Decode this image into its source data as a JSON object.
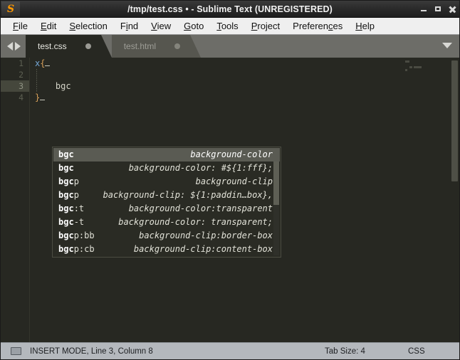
{
  "window": {
    "title": "/tmp/test.css • - Sublime Text (UNREGISTERED)",
    "logo": "sublime-s-logo",
    "controls": {
      "minimize": "minimize-icon",
      "maximize": "maximize-icon",
      "close": "close-icon"
    }
  },
  "menubar": {
    "items": [
      {
        "label": "File",
        "mnemonic_index": 0
      },
      {
        "label": "Edit",
        "mnemonic_index": 0
      },
      {
        "label": "Selection",
        "mnemonic_index": 0
      },
      {
        "label": "Find",
        "mnemonic_index": 1
      },
      {
        "label": "View",
        "mnemonic_index": 0
      },
      {
        "label": "Goto",
        "mnemonic_index": 0
      },
      {
        "label": "Tools",
        "mnemonic_index": 0
      },
      {
        "label": "Project",
        "mnemonic_index": 0
      },
      {
        "label": "Preferences",
        "mnemonic_index": 8
      },
      {
        "label": "Help",
        "mnemonic_index": 0
      }
    ]
  },
  "tabbar": {
    "prev_arrow": "arrow-left-icon",
    "next_arrow": "arrow-right-icon",
    "menu_icon": "chevron-down-icon",
    "tabs": [
      {
        "label": "test.css",
        "active": true,
        "dirty": true
      },
      {
        "label": "test.html",
        "active": false,
        "dirty": true
      }
    ]
  },
  "editor": {
    "lines": [
      {
        "number": "1",
        "active": false,
        "text": "x{"
      },
      {
        "number": "2",
        "active": false,
        "text": ""
      },
      {
        "number": "3",
        "active": true,
        "text": "    bgc"
      },
      {
        "number": "4",
        "active": false,
        "text": "}"
      }
    ]
  },
  "autocomplete": {
    "items": [
      {
        "trigger_bold": "bgc",
        "trigger_rest": "",
        "description": "background-color",
        "selected": true
      },
      {
        "trigger_bold": "bgc",
        "trigger_rest": "",
        "description": "background-color: #${1:fff};",
        "selected": false
      },
      {
        "trigger_bold": "bgc",
        "trigger_rest": "p",
        "description": "background-clip",
        "selected": false
      },
      {
        "trigger_bold": "bgc",
        "trigger_rest": "p",
        "description": "background-clip: ${1:paddin…box},",
        "selected": false
      },
      {
        "trigger_bold": "bgc",
        "trigger_rest": ":t",
        "description": "background-color:transparent",
        "selected": false
      },
      {
        "trigger_bold": "bgc",
        "trigger_rest": "-t",
        "description": "background-color: transparent;",
        "selected": false
      },
      {
        "trigger_bold": "bgc",
        "trigger_rest": "p:bb",
        "description": "background-clip:border-box",
        "selected": false
      },
      {
        "trigger_bold": "bgc",
        "trigger_rest": "p:cb",
        "description": "background-clip:content-box",
        "selected": false
      }
    ]
  },
  "statusbar": {
    "console_icon": "console-icon",
    "position": "INSERT MODE, Line 3, Column 8",
    "tab_size": "Tab Size: 4",
    "syntax": "CSS"
  },
  "colors": {
    "editor_bg": "#272822",
    "accent_orange": "#ff9800",
    "tabbar_bg": "#6d6d68",
    "statusbar_bg": "#b4b8bd",
    "selected_row": "#5a5b53"
  }
}
